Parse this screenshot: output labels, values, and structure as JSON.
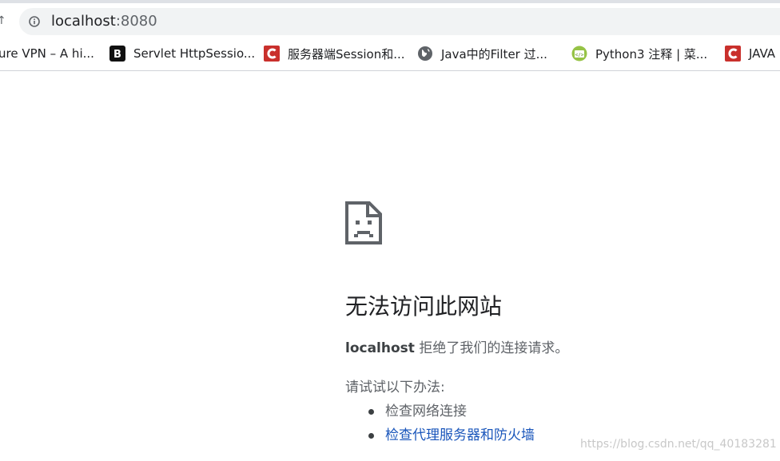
{
  "browser": {
    "url_host": "localhost",
    "url_port": ":8080"
  },
  "bookmarks": [
    {
      "label": "ure VPN – A hi...",
      "icon": "none"
    },
    {
      "label": "Servlet HttpSessio...",
      "icon": "b-square-icon"
    },
    {
      "label": "服务器端Session和...",
      "icon": "csdn-c-icon"
    },
    {
      "label": "Java中的Filter 过...",
      "icon": "globe-icon"
    },
    {
      "label": "Python3 注释 | 菜...",
      "icon": "runoob-code-icon"
    },
    {
      "label": "JAVA",
      "icon": "csdn-c-icon"
    }
  ],
  "error": {
    "title": "无法访问此网站",
    "host": "localhost",
    "message": " 拒绝了我们的连接请求。",
    "suggest_heading": "请试试以下办法:",
    "suggestions": [
      "检查网络连接",
      "检查代理服务器和防火墙"
    ]
  },
  "watermark": "https://blog.csdn.net/qq_40183281",
  "colors": {
    "link": "#1a56bb",
    "csdn_red": "#c9302c",
    "text_dark": "#202124",
    "text_muted": "#5f6368"
  }
}
